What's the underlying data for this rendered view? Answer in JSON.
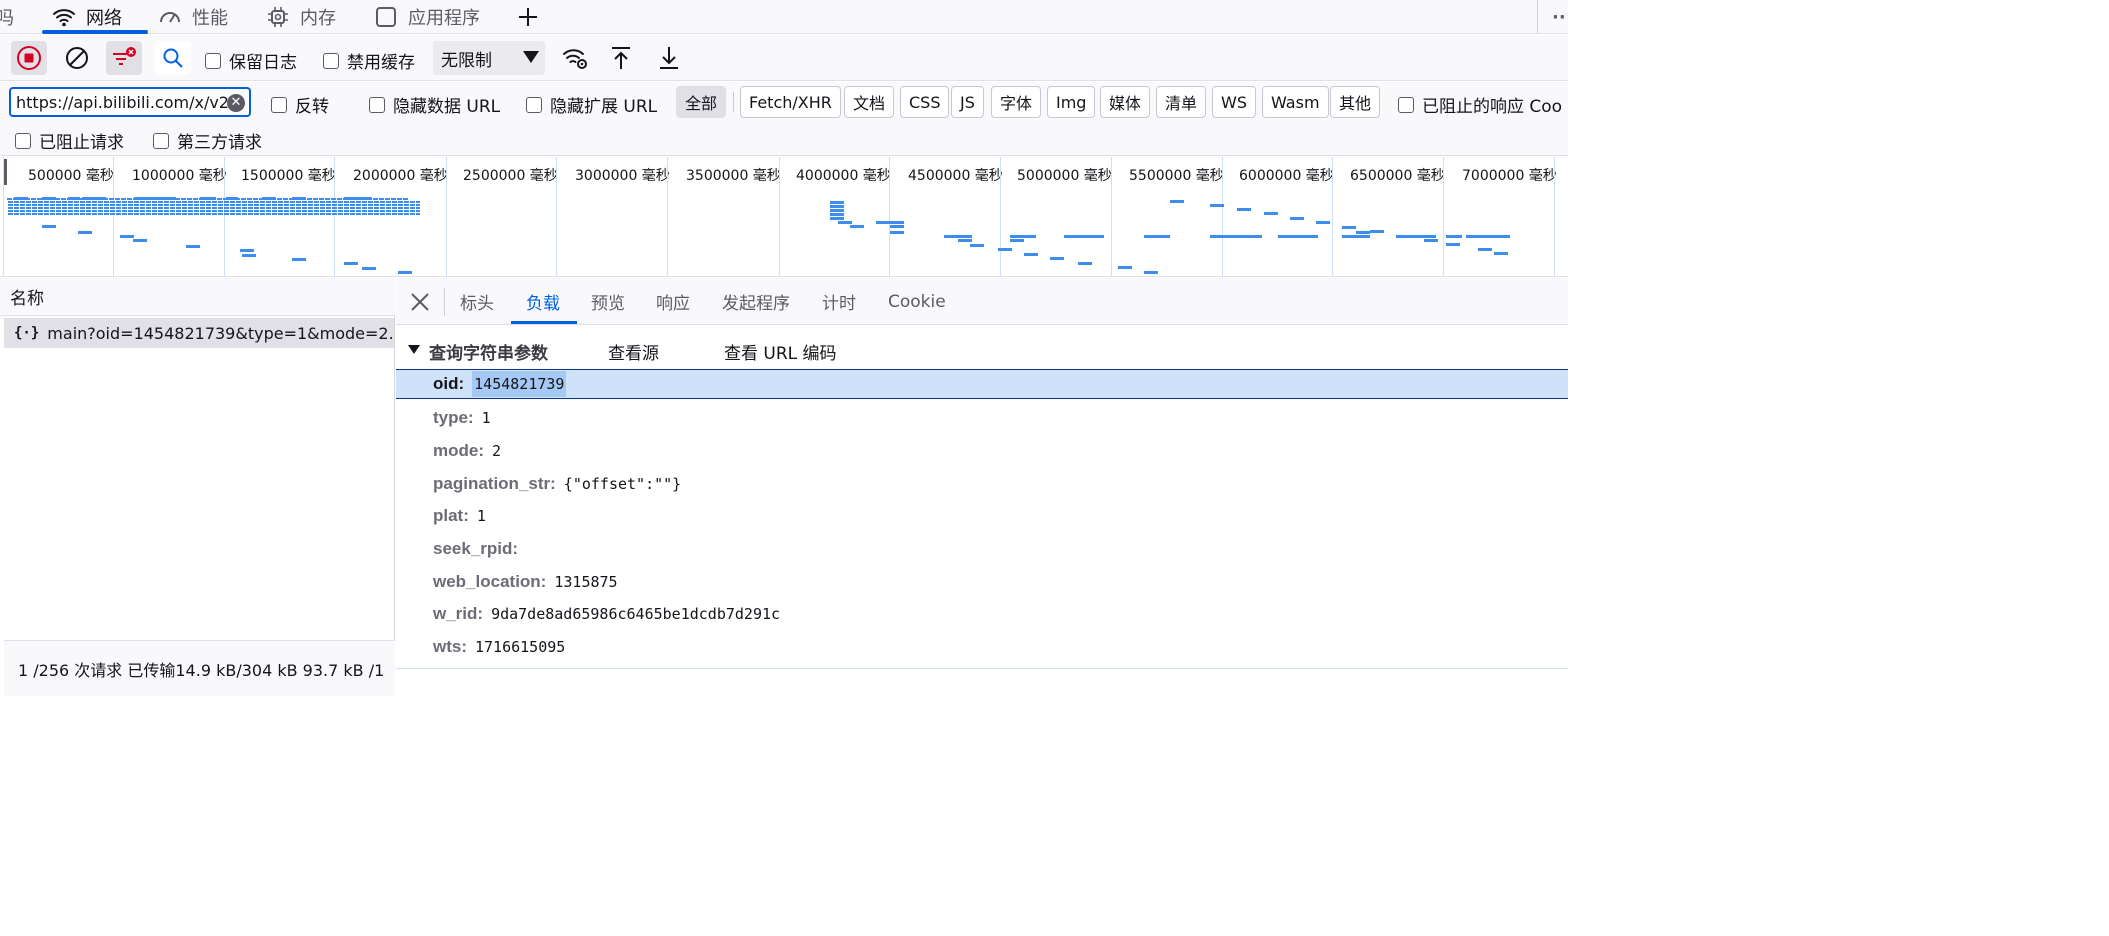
{
  "tabs": {
    "partial_left": "吗",
    "network": "网络",
    "performance": "性能",
    "memory": "内存",
    "application": "应用程序",
    "more": "··"
  },
  "toolbar": {
    "persist_logs": "保留日志",
    "disable_cache": "禁用缓存",
    "throttle": "无限制"
  },
  "filter": {
    "url_value": "https://api.bilibili.com/x/v2",
    "invert": "反转",
    "hide_data_url": "隐藏数据 URL",
    "hide_ext_url": "隐藏扩展 URL",
    "types": [
      "全部",
      "Fetch/XHR",
      "文档",
      "CSS",
      "JS",
      "字体",
      "Img",
      "媒体",
      "清单",
      "WS",
      "Wasm",
      "其他"
    ],
    "blocked_response": "已阻止的响应 Coo",
    "blocked_requests": "已阻止请求",
    "third_party": "第三方请求"
  },
  "timeline": {
    "labels": [
      "500000 毫秒",
      "1000000 毫秒",
      "1500000 毫秒",
      "2000000 毫秒",
      "2500000 毫秒",
      "3000000 毫秒",
      "3500000 毫秒",
      "4000000 毫秒",
      "4500000 毫秒",
      "5000000 毫秒",
      "5500000 毫秒",
      "6000000 毫秒",
      "6500000 毫秒",
      "7000000 毫秒"
    ]
  },
  "requests": {
    "header": "名称",
    "items": [
      {
        "name": "main?oid=1454821739&type=1&mode=2..."
      }
    ],
    "status": "1 /256 次请求  已传输14.9 kB/304 kB  93.7 kB /1"
  },
  "detail": {
    "tabs": [
      "标头",
      "负载",
      "预览",
      "响应",
      "发起程序",
      "计时",
      "Cookie"
    ],
    "section_title": "查询字符串参数",
    "view_source": "查看源",
    "view_url_encoded": "查看 URL 编码",
    "params": [
      {
        "key": "oid:",
        "value": "1454821739"
      },
      {
        "key": "type:",
        "value": "1"
      },
      {
        "key": "mode:",
        "value": "2"
      },
      {
        "key": "pagination_str:",
        "value": "{\"offset\":\"\"}"
      },
      {
        "key": "plat:",
        "value": "1"
      },
      {
        "key": "seek_rpid:",
        "value": ""
      },
      {
        "key": "web_location:",
        "value": "1315875"
      },
      {
        "key": "w_rid:",
        "value": "9da7de8ad65986c6465be1dcdb7d291c"
      },
      {
        "key": "wts:",
        "value": "1716615095"
      }
    ]
  }
}
